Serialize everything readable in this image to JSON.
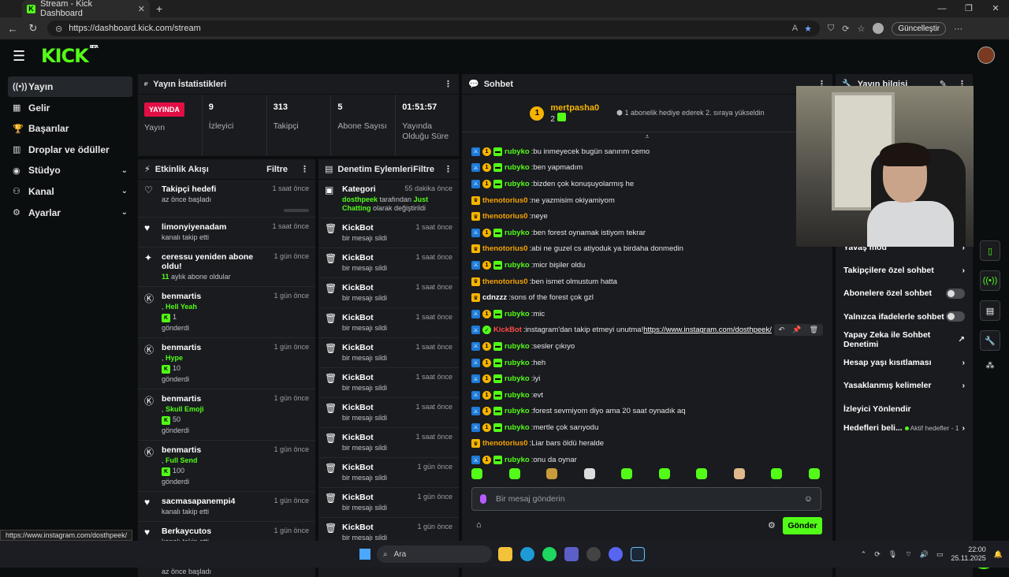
{
  "browser": {
    "tab_title": "Stream - Kick Dashboard",
    "url": "https://dashboard.kick.com/stream",
    "update_label": "Güncelleştir"
  },
  "logo": "KICK",
  "logo_badge": "BETA",
  "sidebar": {
    "items": [
      {
        "label": "Yayın",
        "icon": "broadcast-icon",
        "active": true
      },
      {
        "label": "Gelir",
        "icon": "revenue-icon"
      },
      {
        "label": "Başarılar",
        "icon": "achievements-icon"
      },
      {
        "label": "Droplar ve ödüller",
        "icon": "gift-icon"
      },
      {
        "label": "Stüdyo",
        "icon": "studio-icon",
        "expandable": true
      },
      {
        "label": "Kanal",
        "icon": "channel-icon",
        "expandable": true
      },
      {
        "label": "Ayarlar",
        "icon": "settings-icon",
        "expandable": true
      }
    ]
  },
  "stats": {
    "title": "Yayın İstatistikleri",
    "live_label": "YAYINDA",
    "live_caption": "Yayın",
    "items": [
      {
        "value": "9",
        "label": "İzleyici"
      },
      {
        "value": "313",
        "label": "Takipçi"
      },
      {
        "value": "5",
        "label": "Abone Sayısı"
      },
      {
        "value": "01:51:57",
        "label": "Yayında Olduğu Süre"
      }
    ]
  },
  "activity": {
    "title": "Etkinlik Akışı",
    "filter_label": "Filtre",
    "items": [
      {
        "title": "Takipçi hedefi",
        "sub": "az önce başladı",
        "time": "1 saat önce",
        "icon": "heart-outline-icon"
      },
      {
        "title": "limonyiyenadam",
        "sub": "kanalı takip etti",
        "time": "1 saat önce",
        "icon": "heart-icon"
      },
      {
        "title": "ceressu yeniden abone oldu!",
        "sub_count": "11",
        "sub": "aylık abone oldular",
        "time": "1 gün önce",
        "icon": "sparkle-icon"
      },
      {
        "title": "benmartis",
        "gift": "Hell Yeah",
        "amount": "1",
        "sub": "gönderdi",
        "time": "1 gün önce",
        "icon": "kick-icon"
      },
      {
        "title": "benmartis",
        "gift": "Hype",
        "amount": "10",
        "sub": "gönderdi",
        "time": "1 gün önce",
        "icon": "kick-icon"
      },
      {
        "title": "benmartis",
        "gift": "Skull Emoji",
        "amount": "50",
        "sub": "gönderdi",
        "time": "1 gün önce",
        "icon": "kick-icon"
      },
      {
        "title": "benmartis",
        "gift": "Full Send",
        "amount": "100",
        "sub": "gönderdi",
        "time": "1 gün önce",
        "icon": "kick-icon"
      },
      {
        "title": "sacmasapanempi4",
        "sub": "kanalı takip etti",
        "time": "1 gün önce",
        "icon": "heart-icon"
      },
      {
        "title": "Berkaycutos",
        "sub": "kanalı takip etti",
        "time": "1 gün önce",
        "icon": "heart-icon"
      },
      {
        "title": "Takipçi hedefi",
        "sub": "az önce başladı",
        "time": "1 gün önce",
        "icon": "heart-outline-icon"
      }
    ]
  },
  "moderation": {
    "title": "Denetim Eylemleri",
    "filter_label": "Filtre",
    "first": {
      "title": "Kategori",
      "time": "55 dakika önce",
      "actor": "dosthpeek",
      "middle": "tarafından",
      "target": "Just Chatting",
      "suffix": "olarak değiştirildi"
    },
    "items": [
      {
        "title": "KickBot",
        "sub": "bir mesajı sildi",
        "time": "1 saat önce"
      },
      {
        "title": "KickBot",
        "sub": "bir mesajı sildi",
        "time": "1 saat önce"
      },
      {
        "title": "KickBot",
        "sub": "bir mesajı sildi",
        "time": "1 saat önce"
      },
      {
        "title": "KickBot",
        "sub": "bir mesajı sildi",
        "time": "1 saat önce"
      },
      {
        "title": "KickBot",
        "sub": "bir mesajı sildi",
        "time": "1 saat önce"
      },
      {
        "title": "KickBot",
        "sub": "bir mesajı sildi",
        "time": "1 saat önce"
      },
      {
        "title": "KickBot",
        "sub": "bir mesajı sildi",
        "time": "1 saat önce"
      },
      {
        "title": "KickBot",
        "sub": "bir mesajı sildi",
        "time": "1 saat önce"
      },
      {
        "title": "KickBot",
        "sub": "bir mesajı sildi",
        "time": "1 gün önce"
      },
      {
        "title": "KickBot",
        "sub": "bir mesajı sildi",
        "time": "1 gün önce"
      },
      {
        "title": "KickBot",
        "sub": "bir mesajı sildi",
        "time": "1 gün önce"
      }
    ]
  },
  "chat": {
    "title": "Sohbet",
    "gift_user": "mertpasha0",
    "gift_badge": "1",
    "gift_count": "2",
    "gift_message": "1 abonelik hediye ederek 2. sıraya yükseldin",
    "placeholder": "Bir mesaj gönderin",
    "send_label": "Gönder",
    "messages": [
      {
        "user": "rubyko",
        "color": "green",
        "badges": "full",
        "text": "bu inmeyecek bugün sanırım cemo"
      },
      {
        "user": "rubyko",
        "color": "green",
        "badges": "full",
        "text": "ben yapmadım"
      },
      {
        "user": "rubyko",
        "color": "green",
        "badges": "full",
        "text": "bizden çok konuşuyolarmış he"
      },
      {
        "user": "thenotorius0",
        "color": "orange",
        "badges": "crown",
        "text": "ne yazmisim okiyamiyom"
      },
      {
        "user": "thenotorius0",
        "color": "orange",
        "badges": "crown",
        "text": "neye"
      },
      {
        "user": "rubyko",
        "color": "green",
        "badges": "full",
        "text": "ben forest oynamak istiyom tekrar"
      },
      {
        "user": "thenotorius0",
        "color": "orange",
        "badges": "crown",
        "text": "abi ne guzel cs atiyoduk ya birdaha donmedin"
      },
      {
        "user": "rubyko",
        "color": "green",
        "badges": "full",
        "text": "micr bişiler oldu"
      },
      {
        "user": "thenotorius0",
        "color": "orange",
        "badges": "crown",
        "text": "ben ismet olmustum hatta"
      },
      {
        "user": "cdnzzz",
        "color": "white",
        "badges": "crown",
        "text": "sons of the forest çok gzl"
      },
      {
        "user": "rubyko",
        "color": "green",
        "badges": "full",
        "text": "mic"
      },
      {
        "user": "KickBot",
        "color": "red",
        "badges": "bot",
        "text": "instagram'dan takip etmeyi unutma!",
        "link": "https://www.instagram.com/dosthpeek/"
      },
      {
        "user": "rubyko",
        "color": "green",
        "badges": "full",
        "text": "sesler çıkıyo"
      },
      {
        "user": "rubyko",
        "color": "green",
        "badges": "full",
        "text": "heh"
      },
      {
        "user": "rubyko",
        "color": "green",
        "badges": "full",
        "text": "iyi"
      },
      {
        "user": "rubyko",
        "color": "green",
        "badges": "full",
        "text": "evt"
      },
      {
        "user": "rubyko",
        "color": "green",
        "badges": "full",
        "text": "forest sevmiyom diyo ama 20 saat oynadık aq"
      },
      {
        "user": "rubyko",
        "color": "green",
        "badges": "full",
        "text": "mertle çok sarıyodu"
      },
      {
        "user": "thenotorius0",
        "color": "orange",
        "badges": "crown",
        "text": "Liar bars öldü heralde"
      },
      {
        "user": "rubyko",
        "color": "green",
        "badges": "full",
        "text": "onu da oynar"
      }
    ]
  },
  "stream_info": {
    "title": "Yayın bilgisi",
    "items": [
      {
        "label": "Yavaş mod",
        "control": "chevron"
      },
      {
        "label": "Takipçilere özel sohbet",
        "control": "chevron"
      },
      {
        "label": "Abonelere özel sohbet",
        "control": "toggle"
      },
      {
        "label": "Yalnızca ifadelerle sohbet",
        "control": "toggle"
      },
      {
        "label": "Yapay Zeka ile Sohbet Denetimi",
        "control": "external"
      },
      {
        "label": "Hesap yaşı kısıtlaması",
        "control": "chevron"
      },
      {
        "label": "Yasaklanmış kelimeler",
        "control": "chevron"
      },
      {
        "label": "İzleyici Yönlendir",
        "control": "none"
      }
    ],
    "goals_label": "Hedefleri beli...",
    "goals_status": "Aktif hedefler - 1"
  },
  "status_url": "https://www.instagram.com/dosthpeek/",
  "taskbar": {
    "search_label": "Ara",
    "time": "22:00",
    "date": "25.11.2025"
  },
  "colors": {
    "accent": "#53fc18",
    "live": "#e20f45",
    "panel": "#191b1f",
    "background": "#0b0e0f"
  }
}
